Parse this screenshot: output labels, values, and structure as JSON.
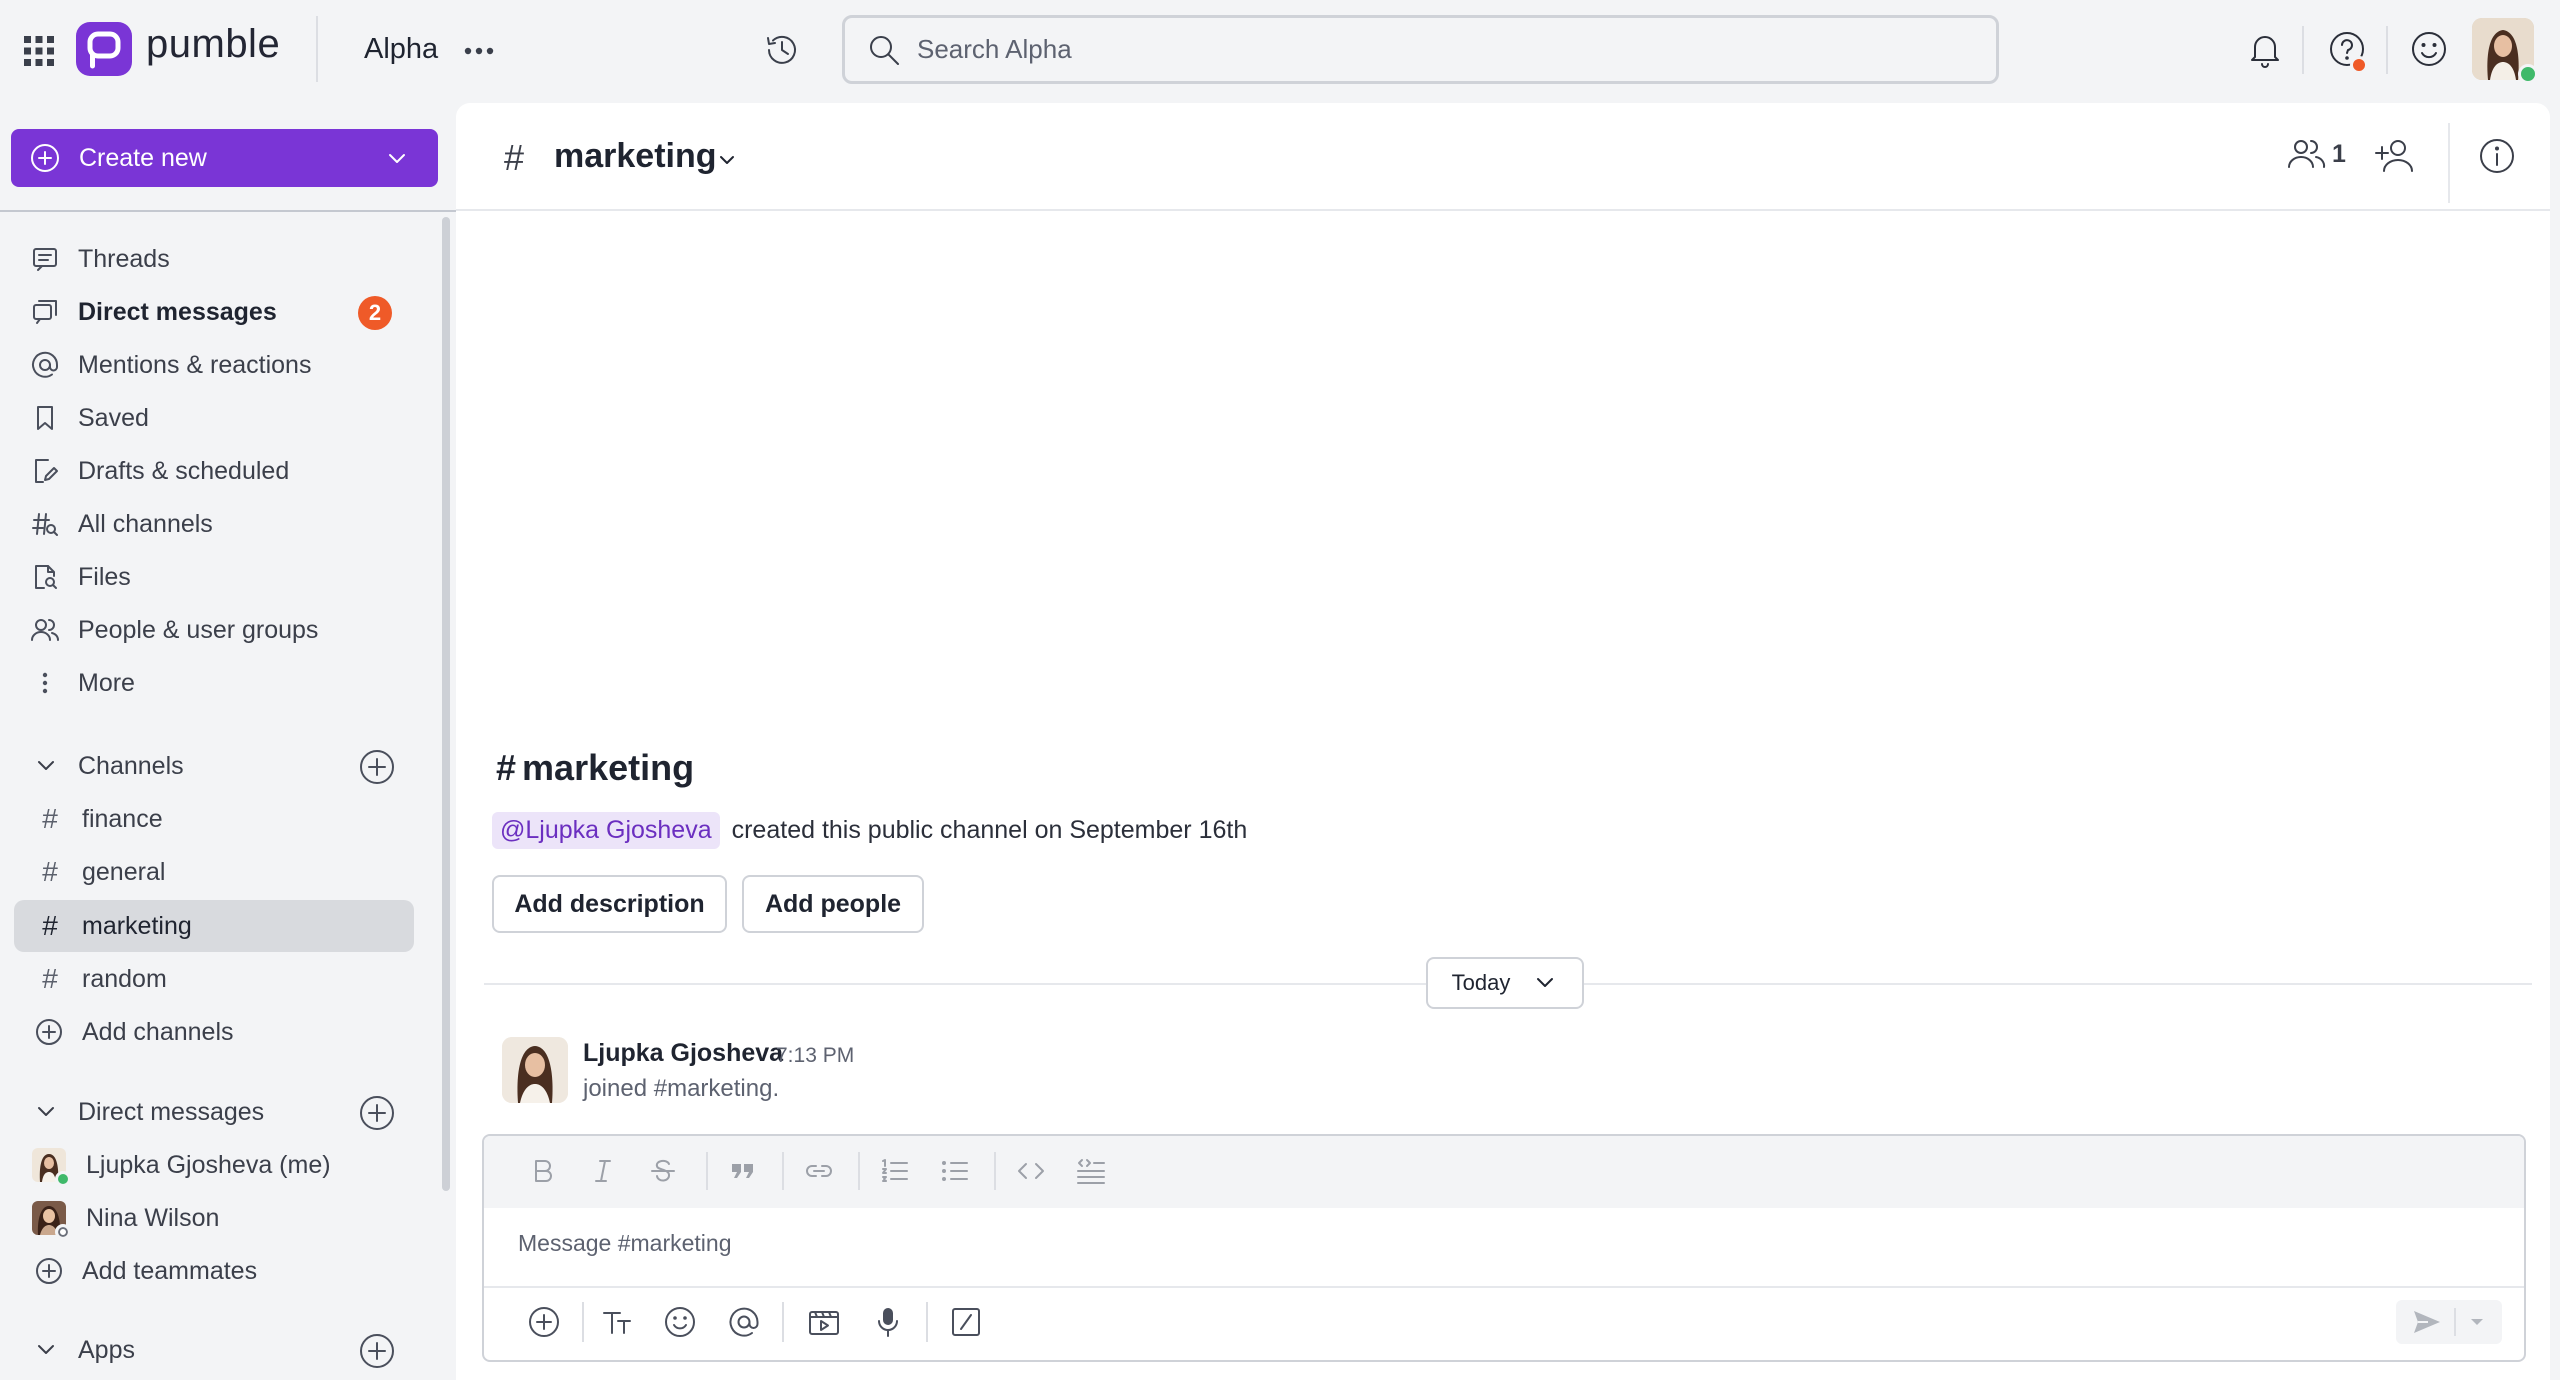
{
  "app": {
    "brand": "pumble",
    "workspace": "Alpha",
    "accent": "#7a35d6",
    "badge_color": "#ef5a28"
  },
  "search": {
    "placeholder": "Search Alpha"
  },
  "sidebar": {
    "create_new": "Create new",
    "nav": [
      {
        "label": "Threads",
        "icon": "threads-icon"
      },
      {
        "label": "Direct messages",
        "icon": "direct-messages-icon",
        "badge": "2"
      },
      {
        "label": "Mentions & reactions",
        "icon": "at-icon"
      },
      {
        "label": "Saved",
        "icon": "bookmark-icon"
      },
      {
        "label": "Drafts & scheduled",
        "icon": "drafts-icon"
      },
      {
        "label": "All channels",
        "icon": "channels-search-icon"
      },
      {
        "label": "Files",
        "icon": "files-icon"
      },
      {
        "label": "People & user groups",
        "icon": "people-icon"
      },
      {
        "label": "More",
        "icon": "more-vertical-icon"
      }
    ],
    "channels_header": "Channels",
    "channels": [
      "finance",
      "general",
      "marketing",
      "random"
    ],
    "active_channel": "marketing",
    "add_channels": "Add channels",
    "dm_header": "Direct messages",
    "dms": [
      {
        "name": "Ljupka Gjosheva (me)",
        "status": "online"
      },
      {
        "name": "Nina Wilson",
        "status": "offline"
      }
    ],
    "add_teammates": "Add teammates",
    "apps_header": "Apps"
  },
  "channel": {
    "name": "marketing",
    "hash": "#",
    "member_count": "1",
    "intro_title": "marketing",
    "creator_mention": "@Ljupka Gjosheva",
    "created_text": "created this public channel on September 16th",
    "add_description": "Add description",
    "add_people": "Add people",
    "date_divider": "Today"
  },
  "messages": [
    {
      "author": "Ljupka Gjosheva",
      "time": "7:13 PM",
      "text": "joined #marketing."
    }
  ],
  "composer": {
    "placeholder": "Message #marketing"
  }
}
